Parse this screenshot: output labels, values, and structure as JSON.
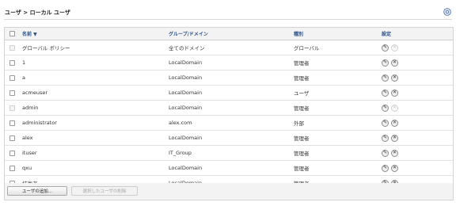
{
  "panel": {
    "title": "ユーザ > ローカル ユーザ"
  },
  "table": {
    "headers": {
      "name": "名前 ▼",
      "group": "グループ/ドメイン",
      "type": "種別",
      "settings": "設定"
    },
    "rows": [
      {
        "name": "グローバル ポリシー",
        "group": "全てのドメイン",
        "type": "グローバル",
        "checkbox_enabled": false,
        "delete_enabled": false
      },
      {
        "name": "1",
        "group": "LocalDomain",
        "type": "管理者",
        "checkbox_enabled": true,
        "delete_enabled": true
      },
      {
        "name": "a",
        "group": "LocalDomain",
        "type": "管理者",
        "checkbox_enabled": true,
        "delete_enabled": true
      },
      {
        "name": "acmeuser",
        "group": "LocalDomain",
        "type": "ユーザ",
        "checkbox_enabled": true,
        "delete_enabled": true
      },
      {
        "name": "admin",
        "group": "LocalDomain",
        "type": "管理者",
        "checkbox_enabled": false,
        "delete_enabled": false
      },
      {
        "name": "administrator",
        "group": "alex.com",
        "type": "外部",
        "checkbox_enabled": true,
        "delete_enabled": true
      },
      {
        "name": "alex",
        "group": "LocalDomain",
        "type": "管理者",
        "checkbox_enabled": true,
        "delete_enabled": true
      },
      {
        "name": "ituser",
        "group": "IT_Group",
        "type": "管理者",
        "checkbox_enabled": true,
        "delete_enabled": true
      },
      {
        "name": "qxu",
        "group": "LocalDomain",
        "type": "管理者",
        "checkbox_enabled": true,
        "delete_enabled": true
      },
      {
        "name": "技術者",
        "group": "LocalDomain",
        "type": "管理者",
        "checkbox_enabled": true,
        "delete_enabled": true
      }
    ]
  },
  "footer": {
    "add_button": "ユーザの追加...",
    "delete_button": "選択したユーザの削除"
  },
  "icons": {
    "edit": "pencil-icon",
    "delete": "x-icon",
    "help": "help-icon"
  },
  "colors": {
    "header_text": "#2a4f86",
    "header_bg": "#f3f3f3"
  }
}
